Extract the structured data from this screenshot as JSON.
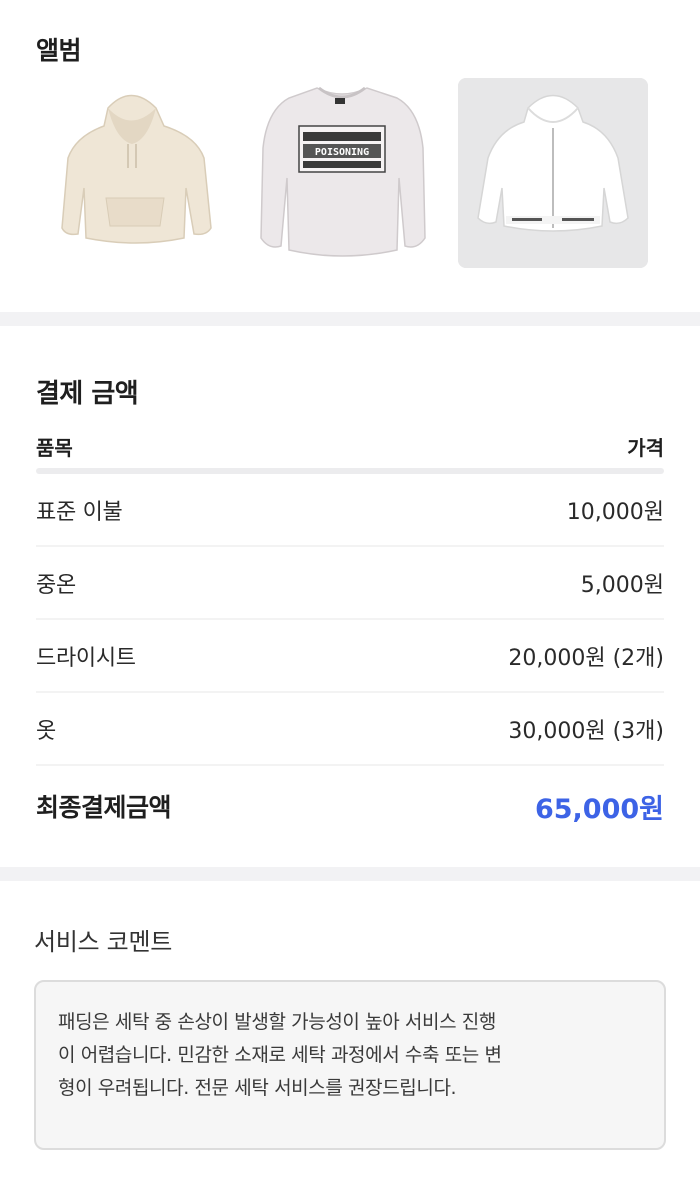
{
  "album": {
    "title": "앨범",
    "photos": [
      {
        "icon": "beige-hoodie-photo"
      },
      {
        "icon": "gray-sweatshirt-photo",
        "print_line1": "POISONING"
      },
      {
        "icon": "white-zip-hoodie-photo"
      }
    ]
  },
  "payment": {
    "title": "결제 금액",
    "col_item": "품목",
    "col_price": "가격",
    "rows": [
      {
        "label": "표준 이불",
        "price": "10,000원"
      },
      {
        "label": "중온",
        "price": "5,000원"
      },
      {
        "label": "드라이시트",
        "price": "20,000원 (2개)"
      },
      {
        "label": "옷",
        "price": "30,000원 (3개)"
      }
    ],
    "total_label": "최종결제금액",
    "total_value": "65,000원",
    "accent_color": "#3d63e6"
  },
  "comment": {
    "title": "서비스 코멘트",
    "lines": [
      "패딩은 세탁 중 손상이 발생할 가능성이 높아 서비스 진행",
      "이 어렵습니다. 민감한 소재로 세탁 과정에서 수축 또는 변",
      "형이 우려됩니다. 전문 세탁 서비스를 권장드립니다."
    ]
  }
}
